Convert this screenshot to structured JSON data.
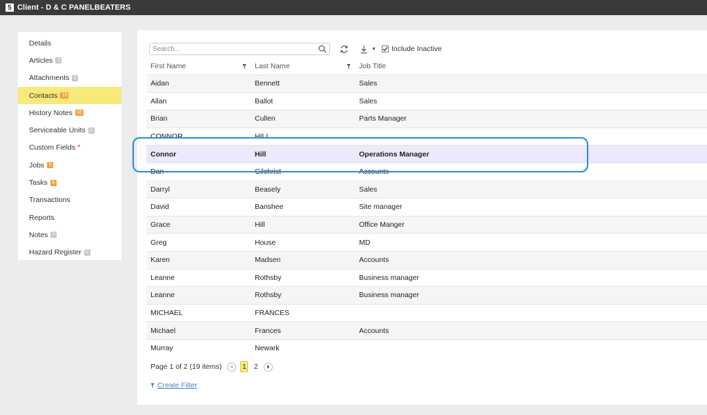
{
  "window": {
    "app_badge": "5",
    "title": "Client - D & C PANELBEATERS"
  },
  "sidebar": {
    "items": [
      {
        "label": "Details",
        "badge": null,
        "required": false,
        "active": false
      },
      {
        "label": "Articles",
        "badge": "0",
        "badge_color": "gray"
      },
      {
        "label": "Attachments",
        "badge": "0",
        "badge_color": "gray"
      },
      {
        "label": "Contacts",
        "badge": "18",
        "badge_color": "orange",
        "active": true
      },
      {
        "label": "History Notes",
        "badge": "10",
        "badge_color": "orange"
      },
      {
        "label": "Serviceable Units",
        "badge": "0",
        "badge_color": "gray"
      },
      {
        "label": "Custom Fields",
        "required": true,
        "required_mark": "*"
      },
      {
        "label": "Jobs",
        "badge": "5",
        "badge_color": "orange"
      },
      {
        "label": "Tasks",
        "badge": "6",
        "badge_color": "orange"
      },
      {
        "label": "Transactions"
      },
      {
        "label": "Reports"
      },
      {
        "label": "Notes",
        "badge": "0",
        "badge_color": "gray"
      },
      {
        "label": "Hazard Register",
        "badge": "0",
        "badge_color": "gray"
      }
    ]
  },
  "toolbar": {
    "search_placeholder": "Search...",
    "include_inactive_label": "Include Inactive",
    "include_inactive_checked": true
  },
  "grid": {
    "columns": [
      "First Name",
      "Last Name",
      "Job Title"
    ],
    "rows": [
      [
        "Aidan",
        "Bennett",
        "Sales"
      ],
      [
        "Allan",
        "Ballot",
        "Sales"
      ],
      [
        "Brian",
        "Cullen",
        "Parts Manager"
      ],
      [
        "CONNOR",
        "HILL",
        ""
      ],
      [
        "Connor",
        "Hill",
        "Operations Manager"
      ],
      [
        "Dan",
        "Gilchrist",
        "Accounts"
      ],
      [
        "Darryl",
        "Beasely",
        "Sales"
      ],
      [
        "David",
        "Banshee",
        "Site manager"
      ],
      [
        "Grace",
        "Hill",
        "Office Manger"
      ],
      [
        "Greg",
        "House",
        "MD"
      ],
      [
        "Karen",
        "Madsen",
        "Accounts"
      ],
      [
        "Leanne",
        "Rothsby",
        "Business manager"
      ],
      [
        "Leanne",
        "Rothsby",
        "Business manager"
      ],
      [
        "MICHAEL",
        "FRANCES",
        ""
      ],
      [
        "Michael",
        "Frances",
        "Accounts"
      ],
      [
        "Murray",
        "Newark",
        ""
      ]
    ],
    "selected_row": 4
  },
  "pager": {
    "summary": "Page 1 of 2 (19 items)",
    "pages": [
      "1",
      "2"
    ],
    "current": "1"
  },
  "filter": {
    "create_label": "Create Filter"
  },
  "colors": {
    "accent": "#f7e97a",
    "highlight_ring": "#2e8fcf",
    "link": "#4a7fc1",
    "badge_orange": "#f0a23b"
  }
}
